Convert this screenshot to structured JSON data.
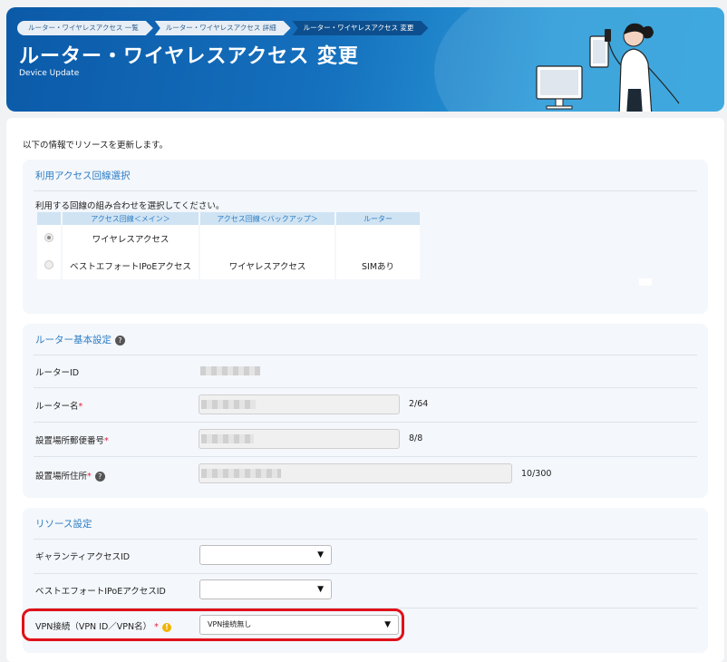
{
  "breadcrumb": [
    {
      "label": "ルーター・ワイヤレスアクセス 一覧"
    },
    {
      "label": "ルーター・ワイヤレスアクセス 詳細"
    },
    {
      "label": "ルーター・ワイヤレスアクセス 変更"
    }
  ],
  "header": {
    "title": "ルーター・ワイヤレスアクセス 変更",
    "subtitle": "Device Update"
  },
  "intro": "以下の情報でリソースを更新します。",
  "line_section": {
    "title": "利用アクセス回線選択",
    "description": "利用する回線の組み合わせを選択してください。",
    "columns": [
      "アクセス回線＜メイン＞",
      "アクセス回線＜バックアップ＞",
      "ルーター"
    ],
    "rows": [
      {
        "main": "ワイヤレスアクセス",
        "backup": "",
        "router": "",
        "selected": true
      },
      {
        "main": "ベストエフォートIPoEアクセス",
        "backup": "ワイヤレスアクセス",
        "router": "SIMあり",
        "selected": false
      }
    ]
  },
  "router_section": {
    "title": "ルーター基本設定",
    "help": "?",
    "router_id_label": "ルーターID",
    "router_name_label": "ルーター名",
    "router_name_counter": "2/64",
    "postal_label": "設置場所郵便番号",
    "postal_counter": "8/8",
    "address_label": "設置場所住所",
    "address_counter": "10/300",
    "required_mark": "*"
  },
  "resource_section": {
    "title": "リソース設定",
    "guarantee_label": "ギャランティアクセスID",
    "guarantee_value": "",
    "besteffort_label": "ベストエフォートIPoEアクセスID",
    "besteffort_value": "",
    "vpn_label": "VPN接続（VPN ID／VPN名）",
    "vpn_value": "VPN接続無し",
    "warn": "!"
  },
  "icons": {
    "caret": "▼"
  },
  "colors": {
    "accent": "#2b7cc4",
    "header": "#1570bd",
    "required": "#e0203a",
    "highlight": "#e0101a"
  }
}
